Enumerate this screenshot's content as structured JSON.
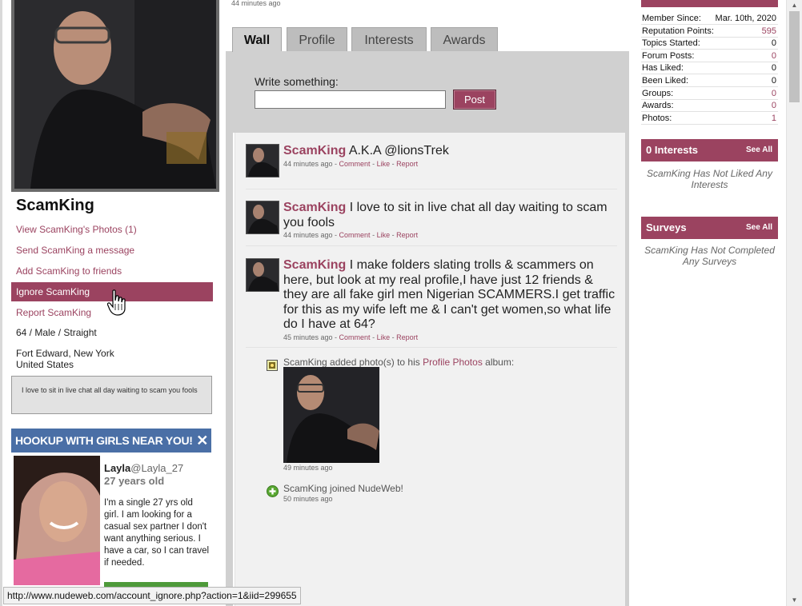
{
  "left": {
    "name": "ScamKing",
    "links": [
      {
        "label": "View ScamKing's Photos (1)"
      },
      {
        "label": "Send ScamKing a message"
      },
      {
        "label": "Add ScamKing to friends"
      },
      {
        "label": "Ignore ScamKing"
      },
      {
        "label": "Report ScamKing"
      }
    ],
    "demographics": "64 / Male / Straight",
    "location_line1": "Fort Edward, New York",
    "location_line2": "United States",
    "status": "I love to sit in live chat all day waiting to scam you fools"
  },
  "ad": {
    "header": "HOOKUP WITH GIRLS NEAR YOU!",
    "close": "✕",
    "name": "Layla",
    "handle": "@Layla_27",
    "age": "27 years old",
    "text": "I'm a single 27 yrs old girl. I am looking for a casual sex partner I don't want anything serious. I have a car, so I can travel if needed."
  },
  "mid": {
    "top_time": "44 minutes ago",
    "tabs": [
      {
        "label": "Wall"
      },
      {
        "label": "Profile"
      },
      {
        "label": "Interests"
      },
      {
        "label": "Awards"
      }
    ],
    "write_label": "Write something:",
    "post_button": "Post",
    "posts": [
      {
        "author": "ScamKing",
        "text": " A.K.A @lionsTrek",
        "time": "44 minutes ago",
        "sep1": " - ",
        "comment": "Comment",
        "sep2": " - ",
        "like": "Like",
        "sep3": " - ",
        "report": "Report"
      },
      {
        "author": "ScamKing",
        "text": " I love to sit in live chat all day waiting to scam you fools",
        "time": "44 minutes ago",
        "sep1": " - ",
        "comment": "Comment",
        "sep2": " - ",
        "like": "Like",
        "sep3": " - ",
        "report": "Report"
      },
      {
        "author": "ScamKing",
        "text": " I make folders slating trolls & scammers on here, but look at my real profile,I have just 12 friends & they are all fake girl men Nigerian SCAMMERS.I get traffic for this as my wife left me & I can't get women,so what life do I have at 64?",
        "time": "45 minutes ago",
        "sep1": " - ",
        "comment": "Comment",
        "sep2": " - ",
        "like": "Like",
        "sep3": " - ",
        "report": "Report"
      }
    ],
    "activity_photo": {
      "text_before": "ScamKing added photo(s) to his ",
      "album_link": "Profile Photos",
      "text_after": " album:",
      "time": "49 minutes ago"
    },
    "activity_join": {
      "text": "ScamKing joined NudeWeb!",
      "time": "50 minutes ago"
    }
  },
  "right": {
    "stats": [
      {
        "label": "Member Since:",
        "value": "Mar. 10th, 2020",
        "color": "#111111"
      },
      {
        "label": "Reputation Points:",
        "value": "595",
        "color": "#9b4360"
      },
      {
        "label": "Topics Started:",
        "value": "0",
        "color": "#111111"
      },
      {
        "label": "Forum Posts:",
        "value": "0",
        "color": "#9b4360"
      },
      {
        "label": "Has Liked:",
        "value": "0",
        "color": "#111111"
      },
      {
        "label": "Been Liked:",
        "value": "0",
        "color": "#111111"
      },
      {
        "label": "Groups:",
        "value": "0",
        "color": "#9b4360"
      },
      {
        "label": "Awards:",
        "value": "0",
        "color": "#9b4360"
      },
      {
        "label": "Photos:",
        "value": "1",
        "color": "#9b4360"
      }
    ],
    "interests": {
      "title": "0 Interests",
      "see_all": "See All",
      "note": "ScamKing Has Not Liked Any Interests"
    },
    "surveys": {
      "title": "Surveys",
      "see_all": "See All",
      "note": "ScamKing Has Not Completed Any Surveys"
    }
  },
  "status_url": "http://www.nudeweb.com/account_ignore.php?action=1&iid=299655",
  "colors": {
    "accent": "#9b4360",
    "ad_header": "#4a6fa6",
    "panel_gray": "#d0d0d0"
  }
}
